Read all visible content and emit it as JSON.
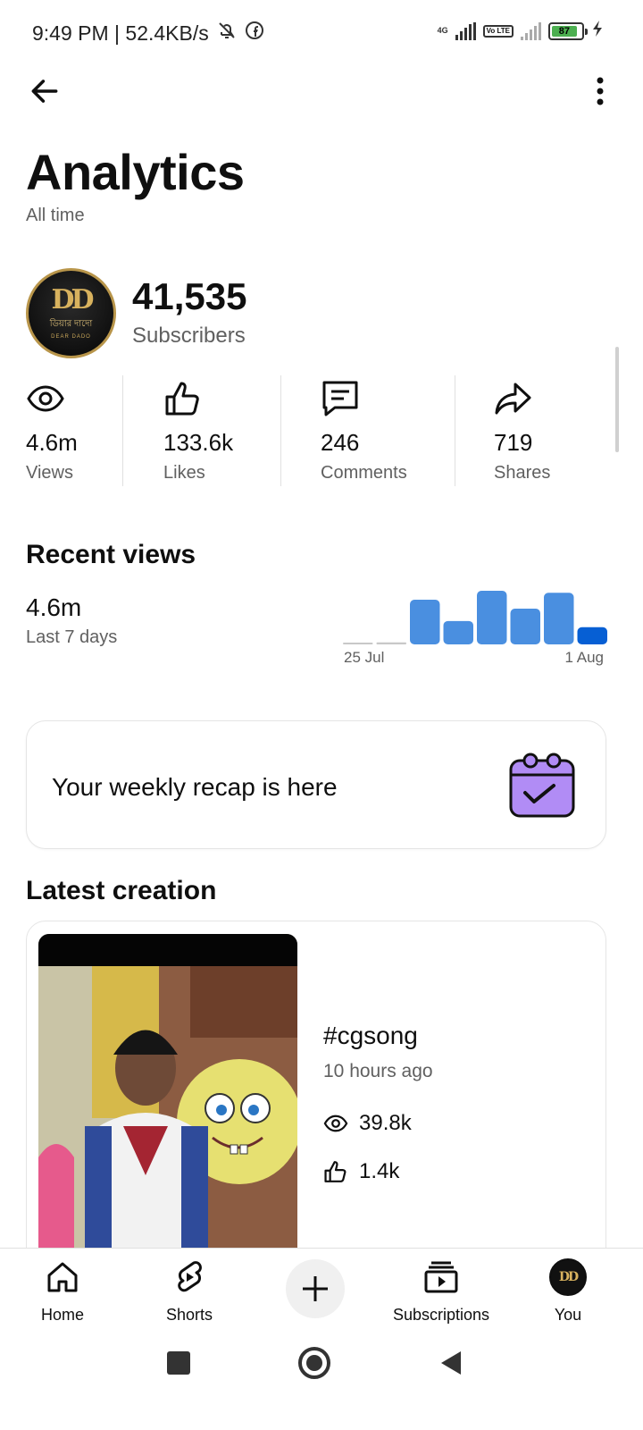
{
  "status_bar": {
    "time_speed": "9:49 PM | 52.4KB/s",
    "network_label": "4G",
    "volte_label": "Vo LTE",
    "battery_level": "87"
  },
  "header": {
    "title": "Analytics",
    "subtitle": "All time"
  },
  "channel": {
    "avatar_logo": "DD",
    "avatar_name": "ডিয়ার দাদো",
    "avatar_name_en": "DEAR DADO",
    "subscribers_count": "41,535",
    "subscribers_label": "Subscribers"
  },
  "stats": [
    {
      "icon": "eye-icon",
      "value": "4.6m",
      "label": "Views"
    },
    {
      "icon": "thumbs-up-icon",
      "value": "133.6k",
      "label": "Likes"
    },
    {
      "icon": "comment-icon",
      "value": "246",
      "label": "Comments"
    },
    {
      "icon": "share-icon",
      "value": "719",
      "label": "Shares"
    }
  ],
  "recent_views": {
    "title": "Recent views",
    "value": "4.6m",
    "period_label": "Last 7 days"
  },
  "chart_data": {
    "type": "bar",
    "categories": [
      "",
      "",
      "",
      "",
      "",
      "",
      "",
      ""
    ],
    "values": [
      2,
      3,
      65,
      34,
      78,
      52,
      75,
      25
    ],
    "highlight_index": 7,
    "x_start_label": "25 Jul",
    "x_end_label": "1 Aug",
    "bar_color": "#4a8fe0",
    "highlight_color": "#065fd4",
    "baseline_color": "#c8c8c8"
  },
  "recap": {
    "text": "Your weekly recap is here",
    "icon": "calendar-check-icon",
    "icon_color": "#a87cf0"
  },
  "latest": {
    "title": "Latest creation",
    "video_title": "#cgsong",
    "age": "10 hours ago",
    "views": "39.8k",
    "likes": "1.4k"
  },
  "bottom_nav": {
    "home": "Home",
    "shorts": "Shorts",
    "subscriptions": "Subscriptions",
    "you": "You"
  }
}
